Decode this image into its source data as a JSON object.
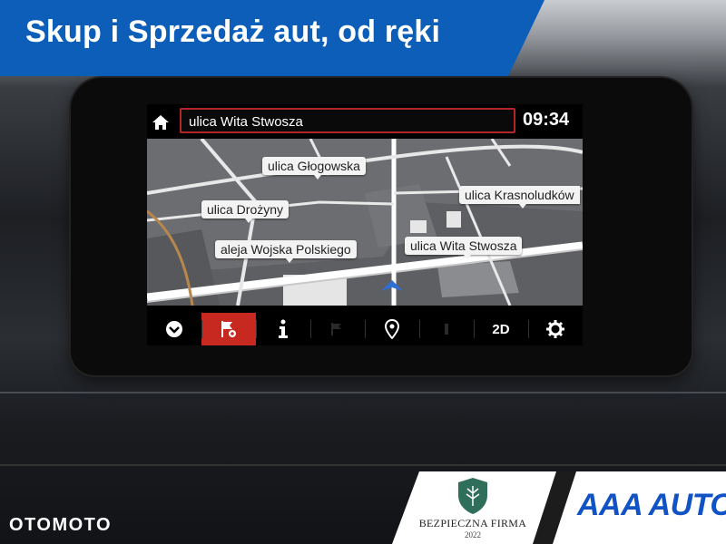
{
  "banner": {
    "text": "Skup i Sprzedaż aut, od ręki"
  },
  "nav": {
    "search_value": "ulica Wita Stwosza",
    "clock": "09:34",
    "map_labels": [
      "ulica Głogowska",
      "ulica Krasnoludków",
      "ulica Drożyny",
      "aleja Wojska Polskiego",
      "ulica Wita Stwosza"
    ],
    "toolbar": [
      {
        "icon": "chevron-down-icon"
      },
      {
        "icon": "flag-add-icon",
        "active": true
      },
      {
        "icon": "info-icon"
      },
      {
        "icon": "disabled-flag-icon"
      },
      {
        "icon": "location-pin-icon"
      },
      {
        "icon": "disabled-icon"
      },
      {
        "label": "2D"
      },
      {
        "icon": "gear-icon"
      }
    ]
  },
  "footer": {
    "firm_name": "BEZPIECZNA FIRMA",
    "firm_year": "2022",
    "brand": "AAA AUTO",
    "watermark": "OTOMOTO"
  },
  "colors": {
    "banner": "#0d5eb8",
    "accent_red": "#c7281f",
    "brand_blue": "#1152c4"
  }
}
